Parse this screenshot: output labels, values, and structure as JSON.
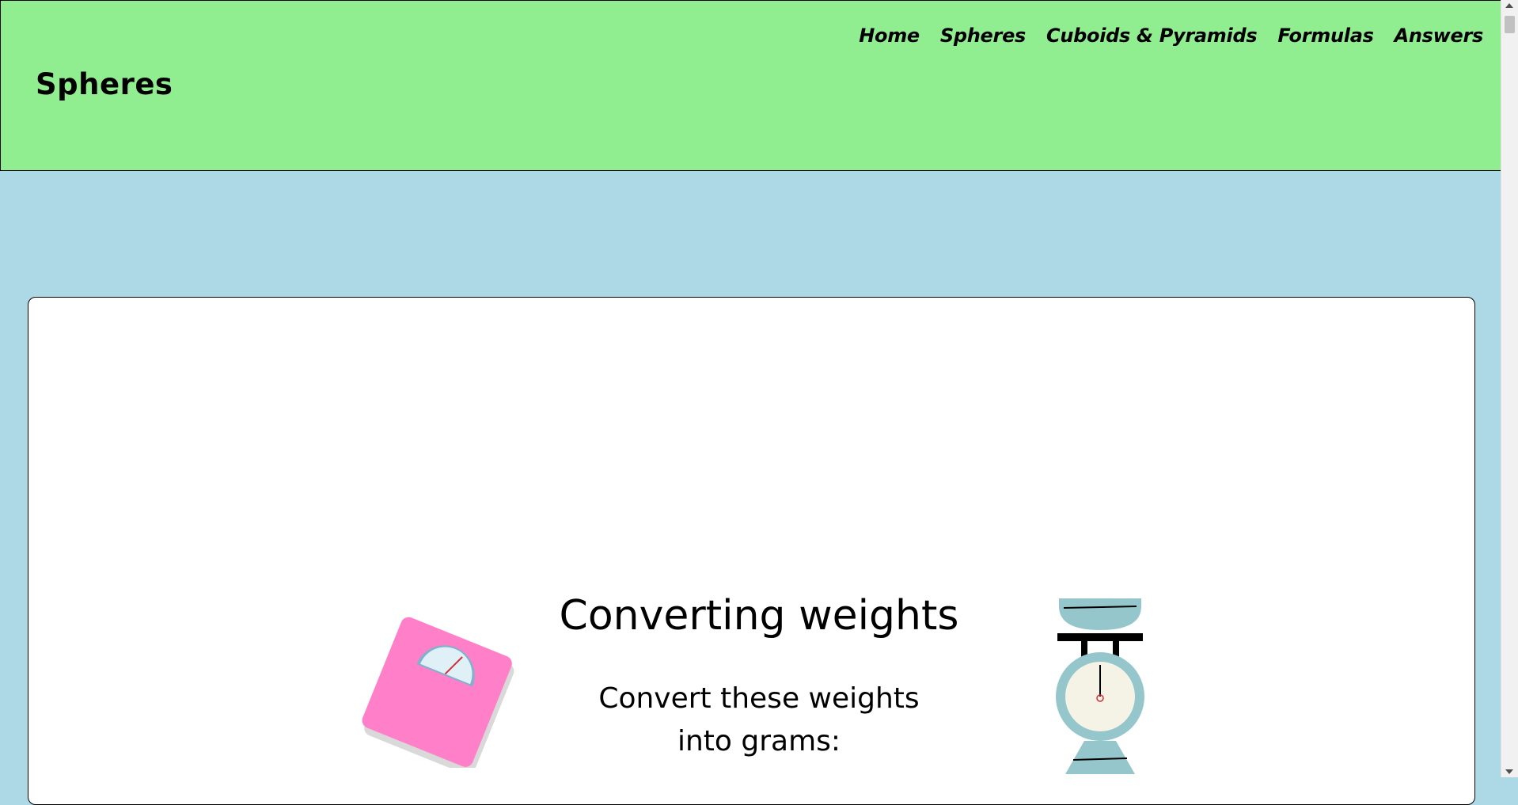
{
  "header": {
    "title": "Spheres",
    "nav": [
      "Home",
      "Spheres",
      "Cuboids & Pyramids",
      "Formulas",
      "Answers"
    ]
  },
  "card": {
    "title": "Converting weights",
    "subtitle_line1": "Convert these weights",
    "subtitle_line2": "into grams:"
  },
  "colors": {
    "page_bg": "#add8e6",
    "header_bg": "#90ee90",
    "card_bg": "#ffffff",
    "bathroom_scale": "#ff7fc8",
    "kitchen_scale": "#95c6cc"
  },
  "icons": [
    "bathroom-scale-icon",
    "kitchen-scale-icon"
  ]
}
